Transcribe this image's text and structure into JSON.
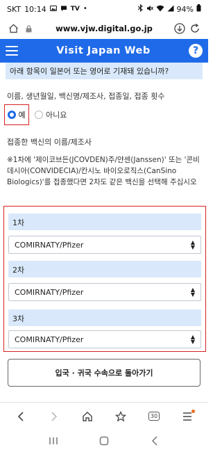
{
  "status_bar": {
    "carrier": "SKT",
    "time": "10:14",
    "battery": "94%"
  },
  "address_bar": {
    "url": "www.vjw.digital.go.jp"
  },
  "header": {
    "title": "Visit Japan Web",
    "help_label": "?"
  },
  "form": {
    "question": "아래 항목이 일본어 또는 영어로 기재돼 있습니까?",
    "fields_label": "이름, 생년월일, 백신명/제조사, 접종일, 접종 횟수",
    "radio_yes": "예",
    "radio_no": "아니요",
    "vaccine_label": "접종한 백신의 이름/제조사",
    "note": "※1차에 '제이코브든(JCOVDEN)주/얀센(Janssen)' 또는 '콘비데시아(CONVIDECIA)/칸시노 바이오로직스(CanSino Biologics)'를 접종했다면 2차도 같은 백신을 선택해 주십시오",
    "doses": [
      {
        "label": "1차",
        "value": "COMIRNATY/Pfizer"
      },
      {
        "label": "2차",
        "value": "COMIRNATY/Pfizer"
      },
      {
        "label": "3차",
        "value": "COMIRNATY/Pfizer"
      }
    ],
    "return_button": "입국 · 귀국 수속으로 돌아가기"
  },
  "browser_toolbar": {
    "tab_count": "30"
  },
  "colors": {
    "brand_blue": "#1f6ae8",
    "highlight_red": "#d62020",
    "banner_blue": "#d9e9fb"
  }
}
